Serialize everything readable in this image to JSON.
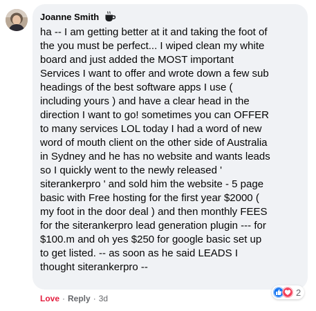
{
  "comment": {
    "author": "Joanne Smith",
    "badge_icon": "coffee-cup-icon",
    "lines": [
      "ha -- I am getting better at it and taking the foot of",
      "the you must be perfect... I wiped clean my white",
      "board and just added the MOST important",
      "Services I want to offer and wrote down a few sub",
      "headings of the best software apps I use (",
      "including yours ) and have a clear head in the",
      "direction I want to go! sometimes you can OFFER",
      "to many services LOL today I had a word of new",
      "word of mouth client on the other side of Australia",
      "in Sydney and he has no website and wants leads",
      "so I quickly went to the newly released '",
      "siterankerpro ' and sold him the website - 5 page",
      "basic with Free hosting for the first year $2000 (",
      "my foot in the door deal ) and then monthly FEES",
      "for the siterankerpro lead generation plugin --- for",
      "$100.m and oh yes $250 for google basic set up",
      "to get listed. -- as soon as he said LEADS I",
      "thought siterankerpro --"
    ]
  },
  "reactions": {
    "icons": [
      "like-reaction-icon",
      "love-reaction-icon"
    ],
    "count": "2"
  },
  "actions": {
    "love_label": "Love",
    "separator": "·",
    "reply_label": "Reply",
    "timestamp": "3d"
  },
  "colors": {
    "bubble": "#f0f2f5",
    "love": "#e41e3f",
    "secondary_text": "#65676b",
    "like_blue": "#1877f2",
    "love_red": "#f33e58"
  }
}
